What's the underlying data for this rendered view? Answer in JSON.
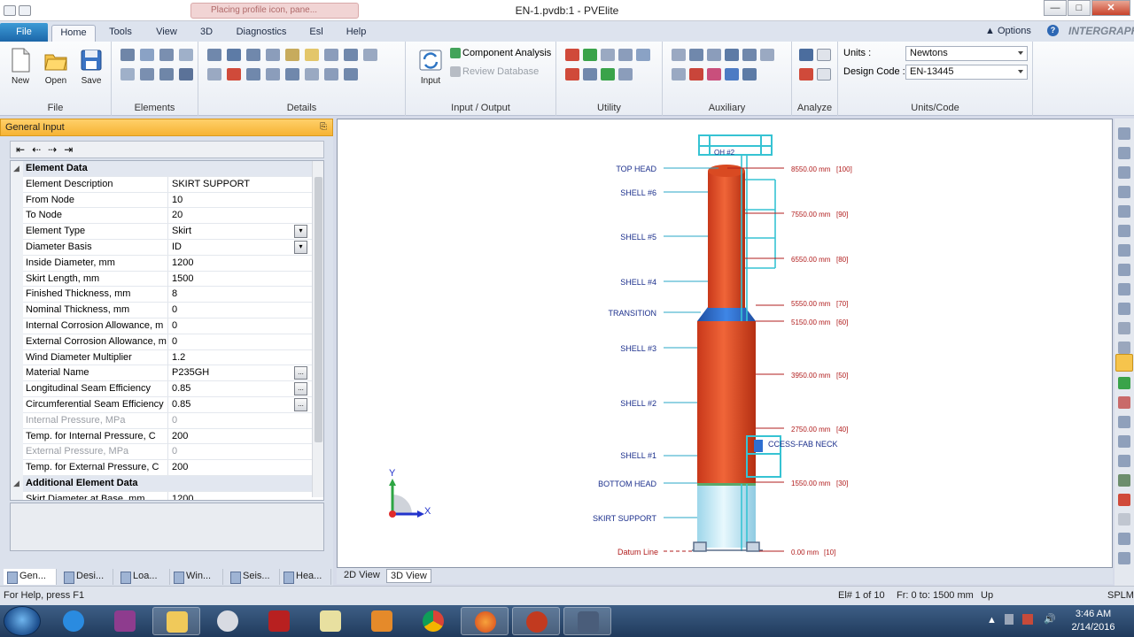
{
  "window": {
    "title": "EN-1.pvdb:1 - PVElite",
    "ghost_tab": "Placing profile icon, pane..."
  },
  "tabs": [
    "File",
    "Home",
    "Tools",
    "View",
    "3D",
    "Diagnostics",
    "Esl",
    "Help"
  ],
  "active_tab": "Home",
  "top_right": {
    "options": "Options",
    "help": "?",
    "brand": "INTERGRAPH"
  },
  "ribbon": {
    "file_group": {
      "new": "New",
      "open": "Open",
      "save": "Save",
      "label": "File"
    },
    "elements_label": "Elements",
    "details_label": "Details",
    "io": {
      "input": "Input",
      "component_analysis": "Component Analysis",
      "review_database": "Review Database",
      "label": "Input / Output"
    },
    "utility_label": "Utility",
    "auxiliary_label": "Auxiliary",
    "analyze_label": "Analyze",
    "units": {
      "units_label": "Units :",
      "units_value": "Newtons",
      "code_label": "Design Code :",
      "code_value": "EN-13445",
      "label": "Units/Code"
    }
  },
  "panel": {
    "title": "General Input",
    "pin": "⸾",
    "categories": {
      "element_data": "Element Data",
      "additional": "Additional Element Data"
    },
    "rows": [
      {
        "name": "Element Description",
        "value": "SKIRT SUPPORT"
      },
      {
        "name": "From Node",
        "value": "10"
      },
      {
        "name": "To Node",
        "value": "20"
      },
      {
        "name": "Element Type",
        "value": "Skirt",
        "control": "dropdown"
      },
      {
        "name": "Diameter Basis",
        "value": "ID",
        "control": "dropdown"
      },
      {
        "name": "Inside Diameter, mm",
        "value": "1200"
      },
      {
        "name": "Skirt Length, mm",
        "value": "1500"
      },
      {
        "name": "Finished Thickness, mm",
        "value": "8"
      },
      {
        "name": "Nominal Thickness, mm",
        "value": "0"
      },
      {
        "name": "Internal Corrosion Allowance, m",
        "value": "0"
      },
      {
        "name": "External Corrosion Allowance, m",
        "value": "0"
      },
      {
        "name": "Wind Diameter Multiplier",
        "value": "1.2"
      },
      {
        "name": "Material Name",
        "value": "P235GH",
        "control": "picker"
      },
      {
        "name": "Longitudinal Seam Efficiency",
        "value": "0.85",
        "control": "picker"
      },
      {
        "name": "Circumferential Seam Efficiency",
        "value": "0.85",
        "control": "picker"
      },
      {
        "name": "Internal Pressure, MPa",
        "value": "0",
        "disabled": true
      },
      {
        "name": "Temp. for Internal Pressure, C",
        "value": "200"
      },
      {
        "name": "External Pressure, MPa",
        "value": "0",
        "disabled": true
      },
      {
        "name": "Temp. for External Pressure, C",
        "value": "200"
      }
    ],
    "partial_row": {
      "name": "Skirt Diameter at Base, mm",
      "value": "1200"
    },
    "bottom_tabs": [
      "Gen...",
      "Desi...",
      "Loa...",
      "Win...",
      "Seis...",
      "Hea..."
    ]
  },
  "viewport": {
    "tabs": [
      "2D View",
      "3D View"
    ],
    "active_view": "3D View",
    "left_labels": [
      "TOP HEAD",
      "SHELL #6",
      "SHELL #5",
      "SHELL #4",
      "TRANSITION",
      "SHELL #3",
      "SHELL #2",
      "SHELL #1",
      "BOTTOM HEAD",
      "SKIRT SUPPORT",
      "Datum Line"
    ],
    "right_labels": [
      {
        "dim": "8550.00 mm",
        "node": "[100]"
      },
      {
        "dim": "7550.00 mm",
        "node": "[90]"
      },
      {
        "dim": "6550.00 mm",
        "node": "[80]"
      },
      {
        "dim": "5550.00 mm",
        "node": "[70]"
      },
      {
        "dim": "5150.00 mm",
        "node": "[60]"
      },
      {
        "dim": "3950.00 mm",
        "node": "[50]"
      },
      {
        "dim": "2750.00 mm",
        "node": "[40]"
      },
      {
        "dim": "1550.00 mm",
        "node": "[30]"
      },
      {
        "dim": "0.00 mm",
        "node": "[10]"
      }
    ],
    "nozzle_labels": {
      "top": "OH #2",
      "side": "CCESS-FAB NECK"
    },
    "axes": {
      "x": "X",
      "y": "Y"
    },
    "colors": {
      "shell": "#e5502a",
      "transition": "#2f6fd1",
      "skirt": "#bfe8f5",
      "ladder": "#36c3d3",
      "leader": "#2aa7c7",
      "dimension": "#b11d1d",
      "label": "#1b2f8c"
    }
  },
  "status": {
    "help": "For Help, press F1",
    "element": "El# 1 of 10",
    "from_to": "Fr: 0 to: 1500 mm",
    "direction": "Up",
    "mode": "SPLM"
  },
  "taskbar": {
    "time": "3:46 AM",
    "date": "2/14/2016"
  }
}
